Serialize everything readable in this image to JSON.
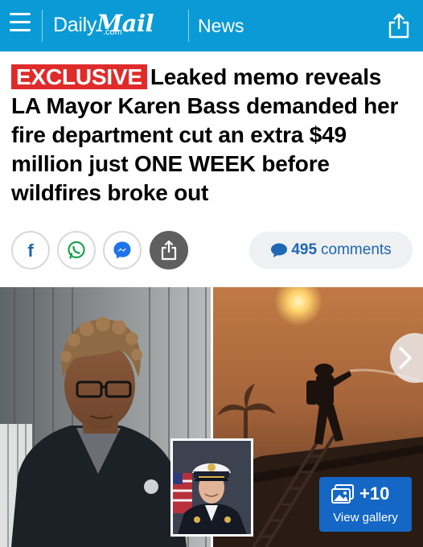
{
  "header": {
    "brand_daily": "Daily",
    "brand_mail": "Mail",
    "brand_com": ".com",
    "section": "News",
    "colors": {
      "bar": "#0a9bd6",
      "text": "#ffffff"
    }
  },
  "article": {
    "badge": "EXCLUSIVE",
    "headline": "Leaked memo reveals LA Mayor Karen Bass demanded her fire department cut an extra $49 million just ONE WEEK before wildfires broke out",
    "badge_color": "#e02b2b"
  },
  "share": {
    "buttons": [
      "facebook-icon",
      "whatsapp-icon",
      "messenger-icon",
      "share-icon"
    ],
    "comments_count": "495",
    "comments_label": "comments"
  },
  "gallery": {
    "count": "+10",
    "label": "View gallery",
    "color": "#1567c6"
  }
}
